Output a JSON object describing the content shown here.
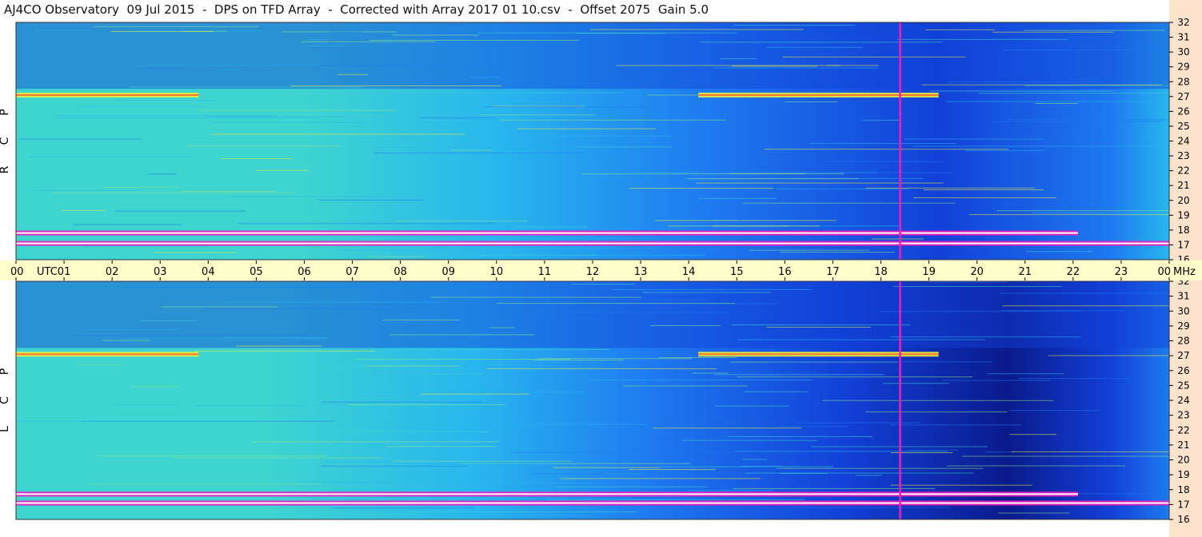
{
  "title": "AJ4CO Observatory  09 Jul 2015  -  DPS on TFD Array  -  Corrected with Array 2017 01 10.csv  -  Offset 2075  Gain 5.0",
  "chart_data": [
    {
      "type": "heatmap",
      "panel": "top",
      "side_label": [
        "R",
        "C",
        "P"
      ],
      "x": {
        "range": [
          0,
          24
        ],
        "unit": "UTC"
      },
      "y": {
        "range": [
          16,
          32
        ],
        "unit": "MHz",
        "ticks": [
          16,
          17,
          18,
          19,
          20,
          21,
          22,
          23,
          24,
          25,
          26,
          27,
          28,
          29,
          30,
          31,
          32
        ]
      },
      "colormap": [
        "#0a1a8c",
        "#1240d8",
        "#1e7af0",
        "#28b6ee",
        "#3ed4d0",
        "#8ae88a",
        "#e8f040",
        "#f87830",
        "#f01cc0",
        "#ffffff"
      ],
      "features": [
        {
          "kind": "band",
          "mhz": 27.1,
          "from_utc": 0.0,
          "to_utc": 3.8,
          "level": 7
        },
        {
          "kind": "band",
          "mhz": 27.1,
          "from_utc": 14.2,
          "to_utc": 19.2,
          "level": 7
        },
        {
          "kind": "band",
          "mhz": 17.8,
          "from_utc": 0.0,
          "to_utc": 22.1,
          "level": 9
        },
        {
          "kind": "band",
          "mhz": 17.1,
          "from_utc": 0.0,
          "to_utc": 24.0,
          "level": 9
        },
        {
          "kind": "line",
          "utc": 18.4,
          "level": 8
        }
      ]
    },
    {
      "type": "heatmap",
      "panel": "bottom",
      "side_label": [
        "L",
        "C",
        "P"
      ],
      "x": {
        "range": [
          0,
          24
        ],
        "unit": "UTC"
      },
      "y": {
        "range": [
          16,
          32
        ],
        "unit": "MHz",
        "ticks": [
          16,
          17,
          18,
          19,
          20,
          21,
          22,
          23,
          24,
          25,
          26,
          27,
          28,
          29,
          30,
          31,
          32
        ]
      },
      "features": [
        {
          "kind": "band",
          "mhz": 27.1,
          "from_utc": 0.0,
          "to_utc": 3.8,
          "level": 7
        },
        {
          "kind": "band",
          "mhz": 27.1,
          "from_utc": 14.2,
          "to_utc": 19.2,
          "level": 7
        },
        {
          "kind": "band",
          "mhz": 17.7,
          "from_utc": 0.0,
          "to_utc": 22.1,
          "level": 9
        },
        {
          "kind": "band",
          "mhz": 17.1,
          "from_utc": 0.0,
          "to_utc": 24.0,
          "level": 9
        },
        {
          "kind": "line",
          "utc": 18.4,
          "level": 8
        }
      ]
    }
  ],
  "time_axis": {
    "labels": [
      "00",
      "01",
      "02",
      "03",
      "04",
      "05",
      "06",
      "07",
      "08",
      "09",
      "10",
      "11",
      "12",
      "13",
      "14",
      "15",
      "16",
      "17",
      "18",
      "19",
      "20",
      "21",
      "22",
      "23",
      "00"
    ],
    "utc_label": "UTC",
    "mhz_label": "MHz"
  },
  "colors": {
    "axis_band": "#ffffcc",
    "right_strip": "#fde2cc"
  }
}
